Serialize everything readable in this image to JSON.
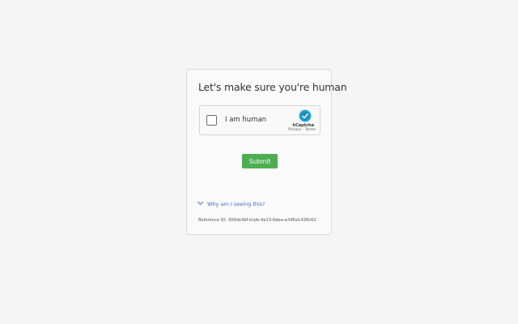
{
  "page": {
    "title": "Let's make sure you're human"
  },
  "captcha": {
    "label": "I am human",
    "brand": "hCaptcha",
    "privacy_link": "Privacy",
    "separator": " - ",
    "terms_link": "Terms",
    "logo_icon": "hcaptcha-logo-icon",
    "checked": false
  },
  "form": {
    "submit_label": "Submit",
    "submit_color": "#4cae4f"
  },
  "help": {
    "why_label": "Why am I seeing this?",
    "expand_icon": "chevron-down-icon",
    "link_color": "#3a6fbf"
  },
  "reference": {
    "text": "Reference ID: 309de3bf-brpb-4a13-8aba-e346a1428c62"
  }
}
